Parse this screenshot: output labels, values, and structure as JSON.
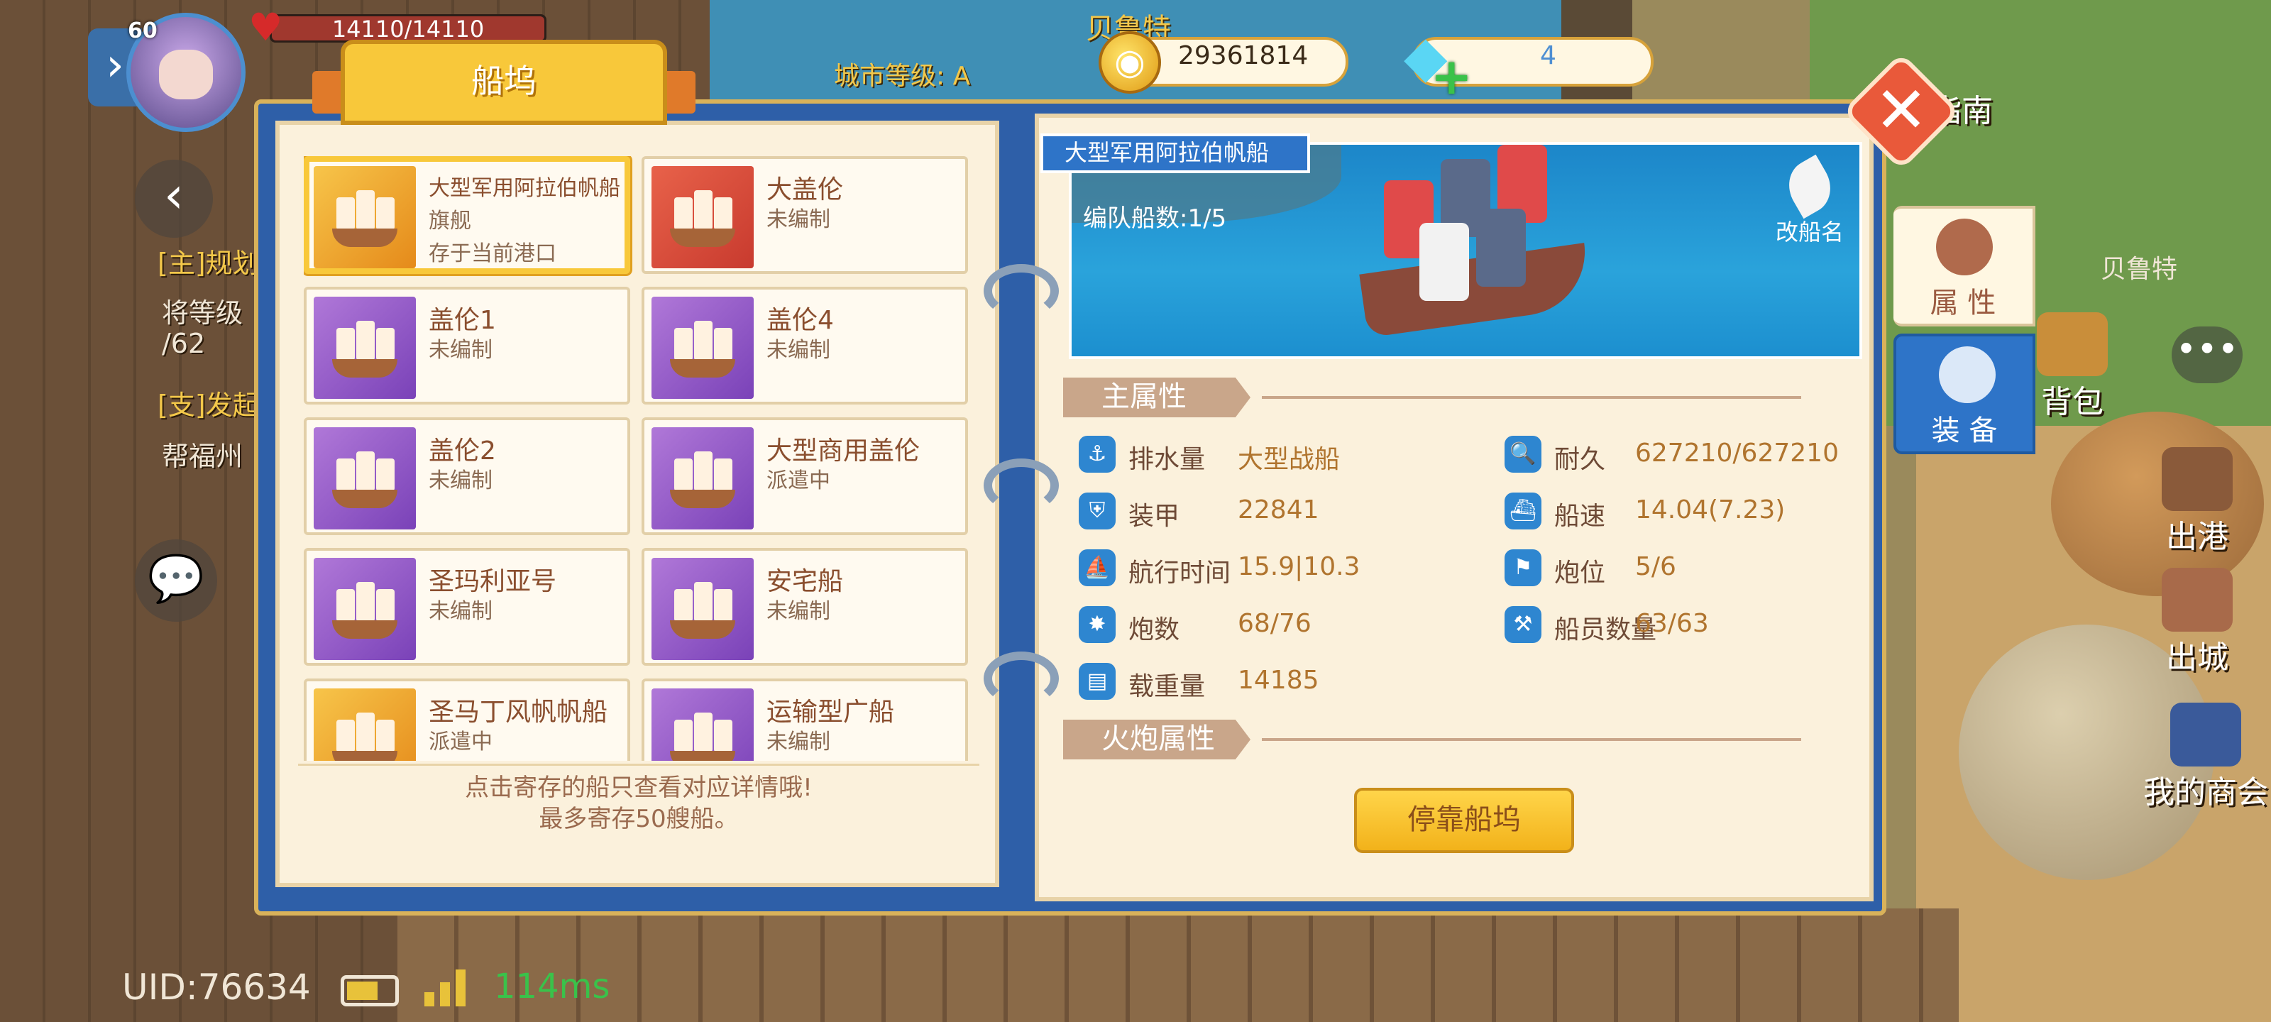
{
  "hud": {
    "level": "60",
    "hp": "14110/14110",
    "city_name": "贝鲁特",
    "city_level": "城市等级: A",
    "gold": "29361814",
    "gems": "4"
  },
  "left_side": {
    "quest_main": "[主]规划",
    "quest_main_sub": "将等级",
    "quest_main_prog": "/62",
    "quest_side": "[支]发起",
    "quest_side_sub": "帮福州"
  },
  "status": {
    "uid": "UID:76634",
    "ping": "114ms"
  },
  "right_side": {
    "guide_label": "指南",
    "location_label": "贝鲁特",
    "bag_label": "背包",
    "depart_label": "出港",
    "exit_city_label": "出城",
    "guild_label": "我的商会",
    "tab_attributes": "属 性",
    "tab_equipment": "装 备"
  },
  "panel": {
    "title": "船坞",
    "left_note_line1": "点击寄存的船只查看对应详情哦!",
    "left_note_line2": "最多寄存50艘船。",
    "ships": [
      {
        "name": "大型军用阿拉伯帆船",
        "line1": "旗舰",
        "line2": "存于当前港口",
        "color": "gold"
      },
      {
        "name": "大盖伦",
        "line1": "未编制",
        "line2": "",
        "color": "red"
      },
      {
        "name": "盖伦1",
        "line1": "未编制",
        "line2": "",
        "color": "purple"
      },
      {
        "name": "盖伦4",
        "line1": "未编制",
        "line2": "",
        "color": "purple"
      },
      {
        "name": "盖伦2",
        "line1": "未编制",
        "line2": "",
        "color": "purple"
      },
      {
        "name": "大型商用盖伦",
        "line1": "派遣中",
        "line2": "",
        "color": "purple"
      },
      {
        "name": "圣玛利亚号",
        "line1": "未编制",
        "line2": "",
        "color": "purple"
      },
      {
        "name": "安宅船",
        "line1": "未编制",
        "line2": "",
        "color": "purple"
      },
      {
        "name": "圣马丁风帆帆船",
        "line1": "派遣中",
        "line2": "",
        "color": "gold"
      },
      {
        "name": "运输型广船",
        "line1": "未编制",
        "line2": "",
        "color": "purple"
      }
    ]
  },
  "detail": {
    "ship_name": "大型军用阿拉伯帆船",
    "fleet_count": "编队船数:1/5",
    "rename": "改船名",
    "main_attr_title": "主属性",
    "cannon_attr_title": "火炮属性",
    "stats_left": [
      {
        "label": "排水量",
        "value": "大型战船"
      },
      {
        "label": "装甲",
        "value": "22841"
      },
      {
        "label": "航行时间",
        "value": "15.9|10.3"
      },
      {
        "label": "炮数",
        "value": "68/76"
      },
      {
        "label": "载重量",
        "value": "14185"
      }
    ],
    "stats_right": [
      {
        "label": "耐久",
        "value": "627210/627210"
      },
      {
        "label": "船速",
        "value": "14.04(7.23)"
      },
      {
        "label": "炮位",
        "value": "5/6"
      },
      {
        "label": "船员数量",
        "value": "63/63"
      }
    ],
    "dock_button": "停靠船坞"
  }
}
